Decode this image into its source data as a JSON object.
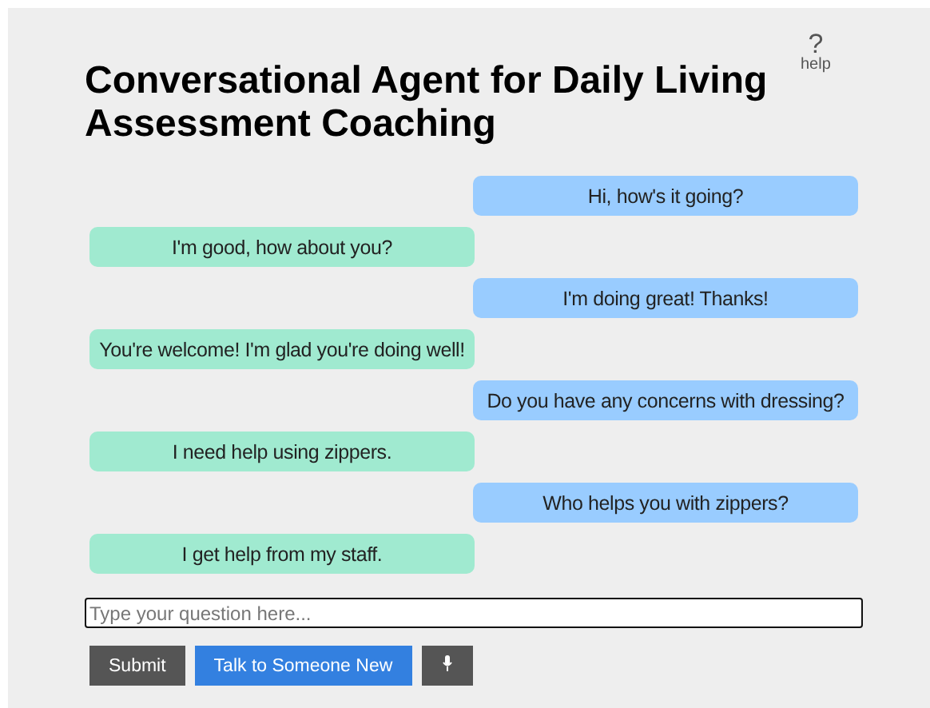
{
  "header": {
    "title": "Conversational Agent for Daily Living Assessment Coaching",
    "help_icon": "?",
    "help_label": "help"
  },
  "messages": [
    {
      "kind": "agent",
      "text": "Hi, how's it going?"
    },
    {
      "kind": "user",
      "text": "I'm good, how about you?"
    },
    {
      "kind": "agent",
      "text": "I'm doing great! Thanks!"
    },
    {
      "kind": "user",
      "text": "You're welcome! I'm glad you're doing well!"
    },
    {
      "kind": "agent",
      "text": "Do you have any concerns with dressing?"
    },
    {
      "kind": "user",
      "text": "I need help using zippers."
    },
    {
      "kind": "agent",
      "text": "Who helps you with zippers?"
    },
    {
      "kind": "user",
      "text": "I get help from my staff."
    }
  ],
  "input": {
    "placeholder": "Type your question here..."
  },
  "buttons": [
    {
      "kind": "submit",
      "label": "Submit"
    },
    {
      "kind": "new",
      "label": "Talk to Someone New"
    },
    {
      "kind": "mic"
    }
  ]
}
